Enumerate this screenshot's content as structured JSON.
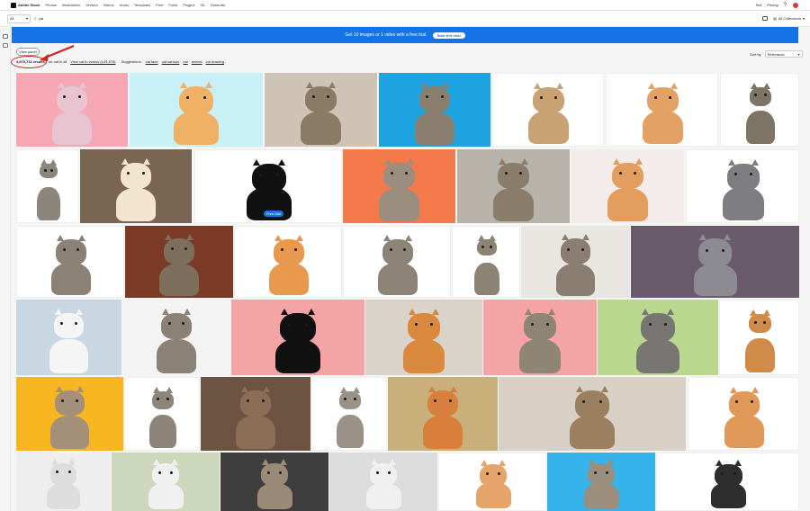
{
  "topnav": {
    "logo_text": "Adobe Stock",
    "links": [
      "Photos",
      "Illustrations",
      "Vectors",
      "Videos",
      "Audio",
      "Templates",
      "Free",
      "Fonts",
      "Plugins",
      "3D",
      "Generate"
    ],
    "sell": "Sell",
    "pricing": "Pricing"
  },
  "search": {
    "filter_value": "All",
    "query": "cat",
    "collections_label": "All Collections"
  },
  "promo": {
    "text": "Get 10 images or 1 video with a free trial.",
    "button": "Start free trial"
  },
  "results": {
    "view_panel": "View panel",
    "count": "3,870,711 results",
    "for_label": "for cat in all",
    "video_label": "View cat in videos (149,578)",
    "suggestions_label": "Suggestions:",
    "suggestions": [
      "cat face",
      "cat cartoon",
      "cat",
      "animal",
      "cat drawing"
    ]
  },
  "sort": {
    "label": "Sort by",
    "value": "Relevance"
  },
  "grid": {
    "free_trial_badge": "Free trial",
    "tile_colors": {
      "pink_cat": "#f7a7b4",
      "teal_bg": "#52d3d8",
      "blue_bg": "#1da3e0",
      "orange_bg": "#f47a4b",
      "gray_cat": "#7d7d84",
      "yellow_bg": "#f7b520",
      "rose_bg": "#f4a4a4",
      "cyan_bg": "#36b3ea"
    }
  }
}
